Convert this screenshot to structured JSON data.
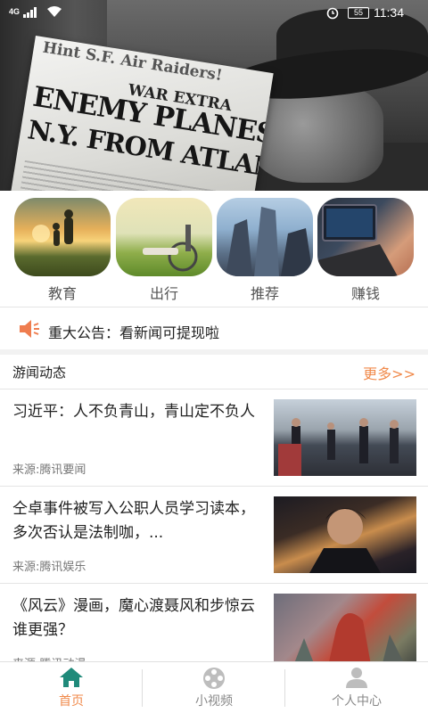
{
  "status_bar": {
    "signal": "4G",
    "battery": "55",
    "time": "11:34"
  },
  "banner": {
    "newspaper_top": "Hint S.F. Air Raiders!",
    "newspaper_extra": "WAR EXTRA",
    "headline_line1": "ENEMY PLANES NEAR",
    "headline_line2": "N.Y. FROM ATLANTIC!"
  },
  "categories": [
    {
      "label": "教育"
    },
    {
      "label": "出行"
    },
    {
      "label": "推荐"
    },
    {
      "label": "赚钱"
    }
  ],
  "notice": {
    "text": "重大公告：看新闻可提现啦"
  },
  "section": {
    "title": "游闻动态",
    "more": "更多>>"
  },
  "news": [
    {
      "headline": "习近平：人不负青山，青山定不负人",
      "source": "来源:腾讯要闻"
    },
    {
      "headline": "仝卓事件被写入公职人员学习读本，多次否认是法制咖，...",
      "source": "来源:腾讯娱乐"
    },
    {
      "headline": "《风云》漫画，魔心渡聂风和步惊云谁更强？",
      "source": "来源:腾讯动漫"
    }
  ],
  "tabs": [
    {
      "label": "首页",
      "icon": "home-icon",
      "active": true
    },
    {
      "label": "小视频",
      "icon": "film-reel-icon",
      "active": false
    },
    {
      "label": "个人中心",
      "icon": "person-icon",
      "active": false
    }
  ],
  "colors": {
    "accent": "#f08a4b",
    "speaker": "#ef7d4f",
    "tab_inactive": "#bdbdbd"
  }
}
